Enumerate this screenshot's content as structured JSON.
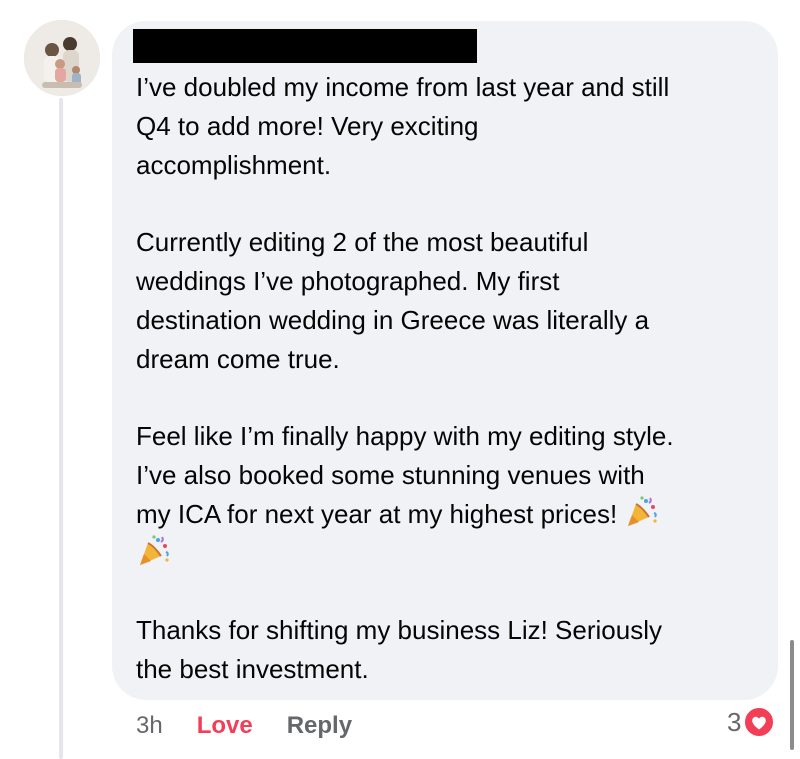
{
  "comment": {
    "paragraphs": [
      "I’ve doubled my income from last year and still\nQ4 to add more! Very exciting\naccomplishment.",
      "Currently editing 2 of the most beautiful\nweddings I’ve photographed. My first\ndestination wedding in Greece was literally a\ndream come true.",
      "Feel like I’m finally happy with my editing style.\nI’ve also booked some stunning venues with\nmy ICA for next year at my highest prices!",
      "Thanks for shifting my business Liz! Seriously\nthe best investment."
    ],
    "emoji": "party-popper-icon"
  },
  "actions": {
    "time": "3h",
    "reaction_label": "Love",
    "reply_label": "Reply"
  },
  "reactions": {
    "count": "3",
    "icon": "heart-icon",
    "color": "#f33e58"
  },
  "colors": {
    "bubble": "#f0f2f5",
    "text": "#050505",
    "secondary": "#65676b",
    "love": "#f33e58"
  }
}
